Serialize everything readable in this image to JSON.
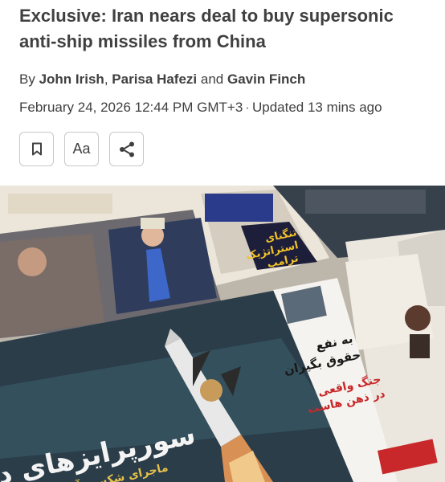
{
  "article": {
    "headline": "Exclusive: Iran nears deal to buy supersonic anti-ship missiles from China",
    "byline_prefix": "By",
    "authors": [
      "John Irish",
      "Parisa Hafezi",
      "Gavin Finch"
    ],
    "byline_sep1": ",",
    "byline_and": "and",
    "published": "February 24, 2026 12:44 PM GMT+3",
    "dot": "·",
    "updated": "Updated 13 mins ago"
  },
  "toolbar": {
    "bookmark_icon": "bookmark-icon",
    "text_size_label": "Aa",
    "share_icon": "share-icon"
  },
  "photo": {
    "description_icon": "newspaper-photo",
    "news_text_main": "سورپرایزهای د",
    "news_text_sub": "ماجرای شکست آمریکا",
    "news_text_mid1": "به نفع",
    "news_text_mid2": "حقوق بگیران",
    "news_text_red": "جنگ واقعی",
    "news_text_red2": "در ذهن هاست",
    "news_text_top": "تنگنای",
    "news_text_top2": "استراتژیک",
    "news_text_top3": "ترامپ"
  }
}
